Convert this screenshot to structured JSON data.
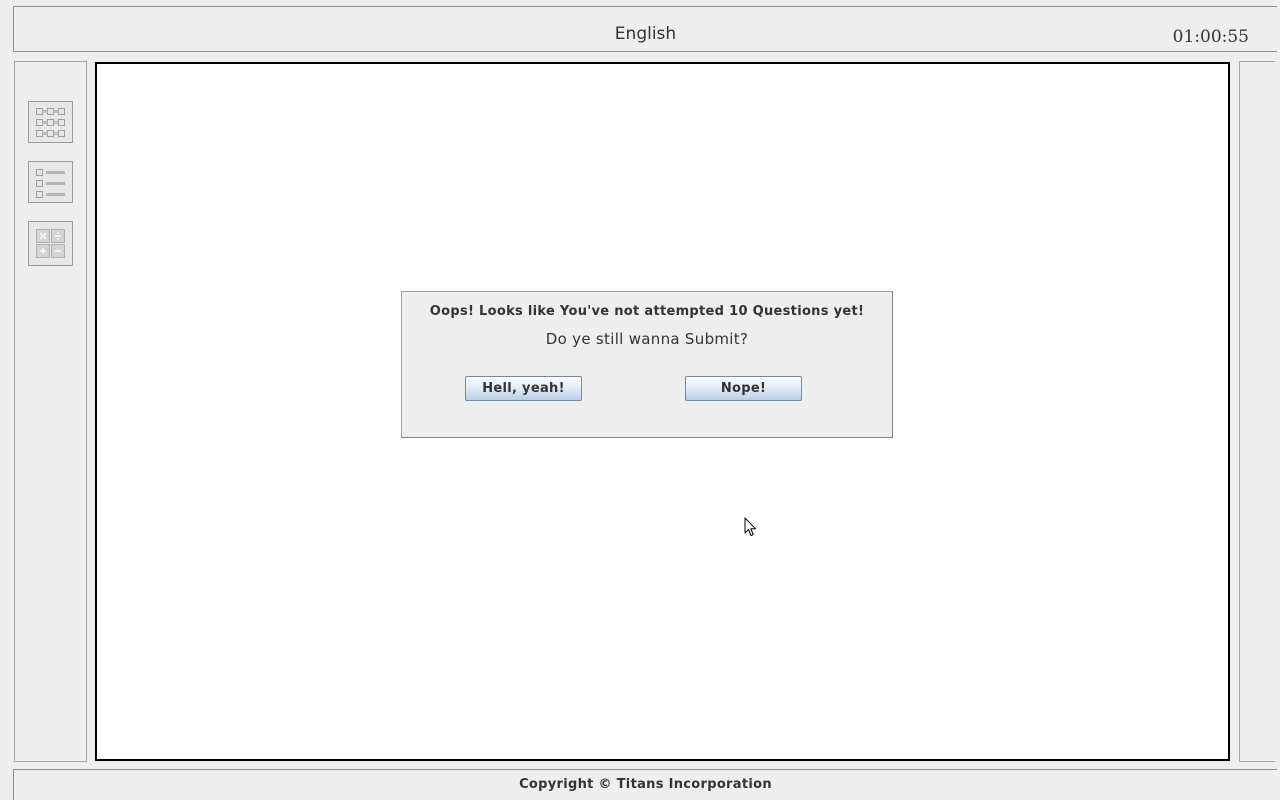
{
  "header": {
    "title": "English",
    "timer": "01:00:55"
  },
  "toolbar": {
    "tools": [
      {
        "icon": "grid-icon"
      },
      {
        "icon": "list-icon"
      },
      {
        "icon": "calculator-icon"
      }
    ]
  },
  "dialog": {
    "message": "Oops! Looks like You've not attempted 10 Questions yet!",
    "question": "Do ye still wanna Submit?",
    "confirm_label": "Hell, yeah!",
    "cancel_label": "Nope!"
  },
  "footer": {
    "copyright": "Copyright  © Titans Incorporation"
  },
  "colors": {
    "background": "#eeeeee",
    "content_background": "#ffffff",
    "content_border": "#000000",
    "button_gradient_bottom": "#b8cfe5"
  }
}
